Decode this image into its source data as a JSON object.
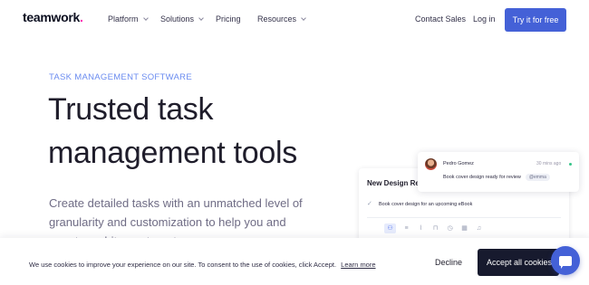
{
  "nav": {
    "logo": "teamwork",
    "logo_dot": ".",
    "items": [
      {
        "label": "Platform",
        "has_dropdown": true
      },
      {
        "label": "Solutions",
        "has_dropdown": true
      },
      {
        "label": "Pricing",
        "has_dropdown": false
      },
      {
        "label": "Resources",
        "has_dropdown": true
      }
    ],
    "contact_sales": "Contact Sales",
    "login": "Log in",
    "cta": "Try it for free"
  },
  "hero": {
    "eyebrow": "TASK MANAGEMENT SOFTWARE",
    "headline_line1": "Trusted task",
    "headline_line2": "management tools",
    "subtext": "Create detailed tasks with an unmatched level of granularity and customization to help you and your team hit your targets."
  },
  "mockup": {
    "task_title": "New Design Request",
    "task_item": "Book cover design for an upcoming eBook",
    "toolbar_icons": [
      "user-icon",
      "list-icon",
      "paperclip-icon",
      "lock-icon",
      "clock-icon",
      "calendar-icon",
      "bell-icon"
    ],
    "comment": {
      "author": "Pedro Gomez",
      "time": "30 mins ago",
      "text": "Book cover design ready for review",
      "mention": "@emma"
    }
  },
  "cookie": {
    "text": "We use cookies to improve your experience on our site. To consent to the use of cookies, click Accept.",
    "learn_more": "Learn more",
    "decline": "Decline",
    "accept": "Accept all cookies"
  },
  "colors": {
    "brand_blue": "#4461d7",
    "logo_dot": "#ff22b1",
    "dark": "#171a2e"
  }
}
